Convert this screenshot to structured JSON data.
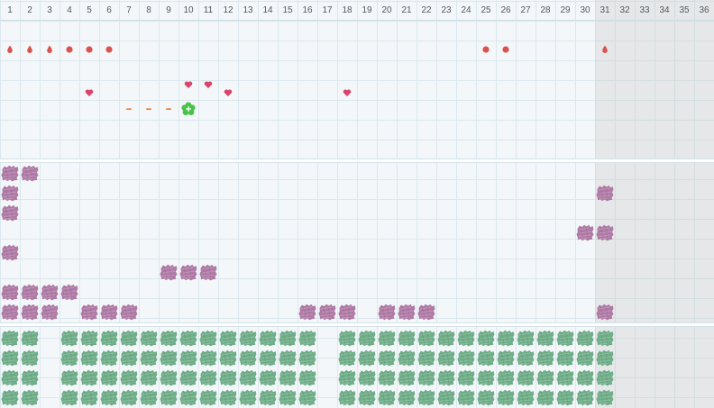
{
  "calendar": {
    "days": [
      "1",
      "2",
      "3",
      "4",
      "5",
      "6",
      "7",
      "8",
      "9",
      "10",
      "11",
      "12",
      "13",
      "14",
      "15",
      "16",
      "17",
      "18",
      "19",
      "20",
      "21",
      "22",
      "23",
      "24",
      "25",
      "26",
      "27",
      "28",
      "29",
      "30",
      "31",
      "32",
      "33",
      "34",
      "35",
      "36"
    ],
    "days_in_month": 31
  },
  "colors": {
    "grid_line": "#dbe8ee",
    "background": "#f3f7f9",
    "inactive_shade": "#e6e7e8",
    "period_red": "#d9534f",
    "heart_pink": "#d9456a",
    "dash_orange": "#f0823c",
    "ovulation_green": "#4cc24a",
    "purple_patch": "#b07aa6",
    "green_patch": "#6fae88"
  },
  "tracks": [
    {
      "name": "period-droplets",
      "icon": "droplet-icon",
      "color": "#d9534f",
      "days": [
        1,
        2,
        3,
        31
      ]
    },
    {
      "name": "period-dots",
      "icon": "dot-icon",
      "color": "#d9534f",
      "days": [
        4,
        5,
        6,
        25,
        26
      ]
    },
    {
      "name": "hearts-upper",
      "icon": "heart-icon",
      "color": "#d9456a",
      "days": [
        10,
        11
      ]
    },
    {
      "name": "hearts-lower",
      "icon": "heart-icon",
      "color": "#d9456a",
      "days": [
        5,
        12,
        18
      ]
    },
    {
      "name": "fertile-dashes",
      "icon": "dash-icon",
      "color": "#f0823c",
      "days": [
        7,
        8,
        9
      ]
    },
    {
      "name": "ovulation",
      "icon": "ovulation-flower-icon",
      "color": "#4cc24a",
      "days": [
        10
      ]
    }
  ],
  "purple_rows": [
    [
      1,
      2
    ],
    [
      1,
      31
    ],
    [
      1
    ],
    [
      30,
      31
    ],
    [
      1
    ],
    [
      9,
      10,
      11
    ],
    [
      1,
      2,
      3,
      4
    ],
    [
      1,
      2,
      3,
      5,
      6,
      7,
      16,
      17,
      18,
      20,
      21,
      22,
      31
    ]
  ],
  "green_rows": [
    [
      1,
      2,
      4,
      5,
      6,
      7,
      8,
      9,
      10,
      11,
      12,
      13,
      14,
      15,
      16,
      18,
      19,
      20,
      21,
      22,
      23,
      24,
      25,
      26,
      27,
      28,
      29,
      30,
      31
    ],
    [
      1,
      2,
      4,
      5,
      6,
      7,
      8,
      9,
      10,
      11,
      12,
      13,
      14,
      15,
      16,
      18,
      19,
      20,
      21,
      22,
      23,
      24,
      25,
      26,
      27,
      28,
      29,
      30,
      31
    ],
    [
      1,
      2,
      4,
      5,
      6,
      7,
      8,
      9,
      10,
      11,
      12,
      13,
      14,
      15,
      16,
      18,
      19,
      20,
      21,
      22,
      23,
      24,
      25,
      26,
      27,
      28,
      29,
      30,
      31
    ],
    [
      1,
      2,
      4,
      5,
      6,
      7,
      8,
      9,
      10,
      11,
      12,
      13,
      14,
      15,
      16,
      18,
      19,
      20,
      21,
      22,
      23,
      24,
      25,
      26,
      27,
      28,
      29,
      30,
      31
    ]
  ]
}
